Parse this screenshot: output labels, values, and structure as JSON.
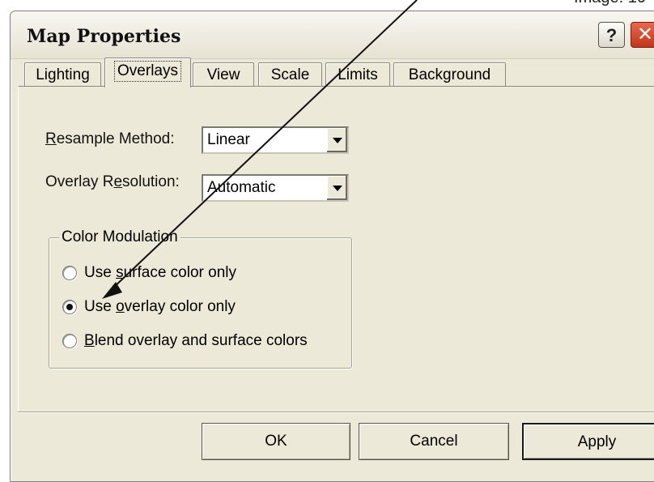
{
  "outer_caption": "Image: 10",
  "window": {
    "title": "Map Properties",
    "help_glyph": "?",
    "close_glyph": "✕"
  },
  "tabs": [
    {
      "label": "Lighting"
    },
    {
      "label": "Overlays",
      "active": true
    },
    {
      "label": "View"
    },
    {
      "label": "Scale"
    },
    {
      "label": "Limits"
    },
    {
      "label": "Background"
    }
  ],
  "form": {
    "resample": {
      "label_accel": "R",
      "label_rest": "esample Method:",
      "value": "Linear"
    },
    "resolution": {
      "label_pre": "Overlay R",
      "label_accel": "e",
      "label_post": "solution:",
      "value": "Automatic"
    }
  },
  "color_modulation": {
    "legend": "Color Modulation",
    "options": [
      {
        "pre": "Use ",
        "accel": "s",
        "post": "urface color only",
        "checked": false
      },
      {
        "pre": "Use ",
        "accel": "o",
        "post": "verlay color only",
        "checked": true
      },
      {
        "pre": "",
        "accel": "B",
        "post": "lend overlay and surface colors",
        "checked": false
      }
    ]
  },
  "buttons": {
    "ok": "OK",
    "cancel": "Cancel",
    "apply": "Apply"
  },
  "colors": {
    "dialog_bg": "#ece9d8",
    "close_red": "#c3351b"
  }
}
